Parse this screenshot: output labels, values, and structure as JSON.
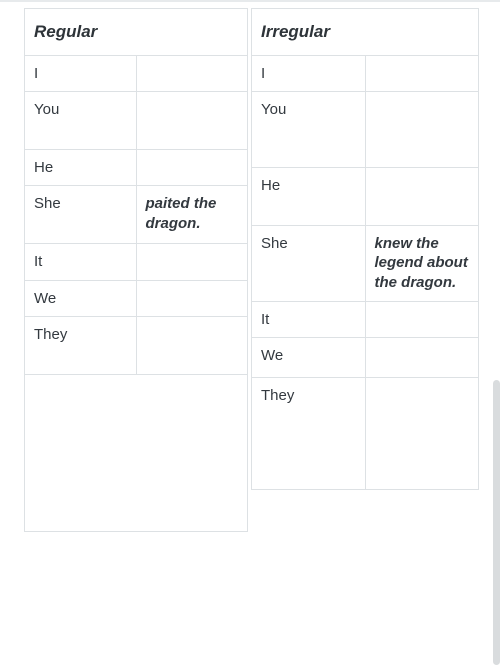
{
  "tables": {
    "regular": {
      "header": "Regular",
      "rows": [
        {
          "pronoun": "I",
          "answer": ""
        },
        {
          "pronoun": "You",
          "answer": ""
        },
        {
          "pronoun": "He",
          "answer": ""
        },
        {
          "pronoun": "She",
          "answer": "paited the dragon."
        },
        {
          "pronoun": "It",
          "answer": ""
        },
        {
          "pronoun": "We",
          "answer": ""
        },
        {
          "pronoun": "They",
          "answer": ""
        }
      ]
    },
    "irregular": {
      "header": "Irregular",
      "rows": [
        {
          "pronoun": "I",
          "answer": ""
        },
        {
          "pronoun": "You",
          "answer": ""
        },
        {
          "pronoun": "He",
          "answer": ""
        },
        {
          "pronoun": "She",
          "answer": "knew the legend about the dragon."
        },
        {
          "pronoun": "It",
          "answer": ""
        },
        {
          "pronoun": "We",
          "answer": ""
        },
        {
          "pronoun": "They",
          "answer": ""
        }
      ]
    }
  }
}
